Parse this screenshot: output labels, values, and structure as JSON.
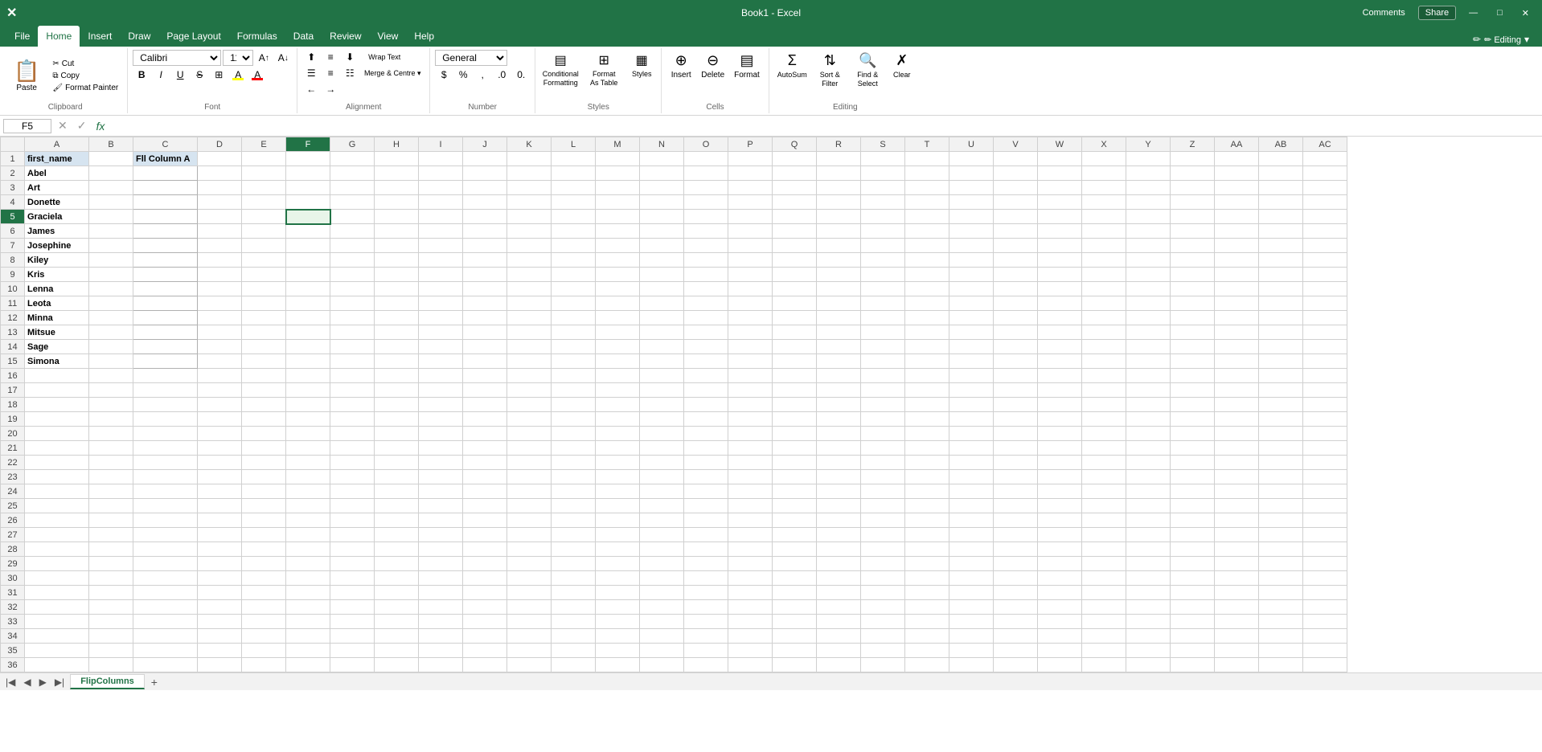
{
  "titleBar": {
    "appName": "Microsoft Excel",
    "fileName": "Book1 - Excel",
    "comments": "Comments",
    "share": "Share"
  },
  "ribbon": {
    "tabs": [
      "File",
      "Home",
      "Insert",
      "Draw",
      "Page Layout",
      "Formulas",
      "Data",
      "Review",
      "View",
      "Help"
    ],
    "activeTab": "Home",
    "editingIndicator": "✏ Editing",
    "groups": {
      "clipboard": {
        "label": "Clipboard",
        "paste": "Paste",
        "copy": "Copy",
        "formatPainter": "Format Painter",
        "cut": "Cut"
      },
      "font": {
        "label": "Font",
        "fontName": "Calibri",
        "fontSize": "11",
        "increaseFontSize": "A↑",
        "decreaseFontSize": "A↓",
        "bold": "B",
        "italic": "I",
        "underline": "U",
        "strikethrough": "S̶"
      },
      "alignment": {
        "label": "Alignment",
        "wrapText": "Wrap Text",
        "mergeCenter": "Merge & Centre ▾"
      },
      "number": {
        "label": "Number",
        "format": "General"
      },
      "styles": {
        "label": "Styles",
        "conditionalFormatting": "Conditional Formatting",
        "formatAsTable": "Format As Table",
        "styles": "Styles"
      },
      "cells": {
        "label": "Cells",
        "insert": "Insert",
        "delete": "Delete",
        "format": "Format"
      },
      "editing": {
        "label": "Editing",
        "autoSum": "AutoSum",
        "clear": "Clear",
        "sortFilter": "Sort & Filter",
        "findSelect": "Find & Select"
      }
    }
  },
  "formulaBar": {
    "nameBox": "F5",
    "cancelSymbol": "✕",
    "confirmSymbol": "✓",
    "fx": "fx",
    "formula": ""
  },
  "columns": [
    "A",
    "B",
    "C",
    "D",
    "E",
    "F",
    "G",
    "H",
    "I",
    "J",
    "K",
    "L",
    "M",
    "N",
    "O",
    "P",
    "Q",
    "R",
    "S",
    "T",
    "U",
    "V",
    "W",
    "X",
    "Y",
    "Z",
    "AA",
    "AB",
    "AC"
  ],
  "rows": 36,
  "data": {
    "A1": "first_name",
    "C1": "Fll Column A",
    "A2": "Abel",
    "A3": "Art",
    "A4": "Donette",
    "A5": "Graciela",
    "A6": "James",
    "A7": "Josephine",
    "A8": "Kiley",
    "A9": "Kris",
    "A10": "Lenna",
    "A11": "Leota",
    "A12": "Minna",
    "A13": "Mitsue",
    "A14": "Sage",
    "A15": "Simona"
  },
  "selectedCell": "F5",
  "activeColumn": "F",
  "activeRow": 5,
  "sheetTabs": [
    {
      "name": "FlipColumns",
      "active": true
    }
  ],
  "statusBar": {
    "addSheet": "+",
    "navLeft": "◀",
    "navRight": "▶"
  }
}
